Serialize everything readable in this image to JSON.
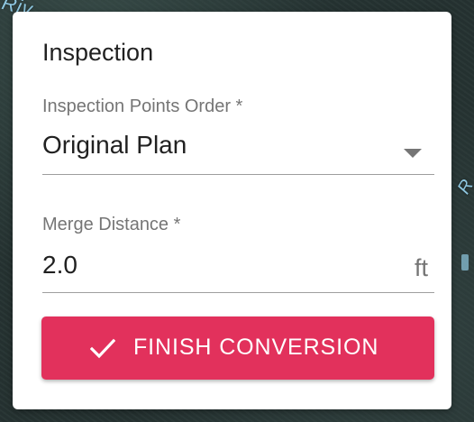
{
  "background": {
    "map_label_top": "Riv",
    "map_label_right": "R"
  },
  "panel": {
    "title": "Inspection",
    "order_field": {
      "label": "Inspection Points Order *",
      "value": "Original Plan"
    },
    "merge_field": {
      "label": "Merge Distance *",
      "value": "2.0",
      "unit": "ft"
    },
    "finish_button": {
      "label": "FINISH CONVERSION",
      "icon": "check-icon"
    }
  },
  "colors": {
    "accent": "#e2315c",
    "map_label": "#8ec7e0"
  }
}
